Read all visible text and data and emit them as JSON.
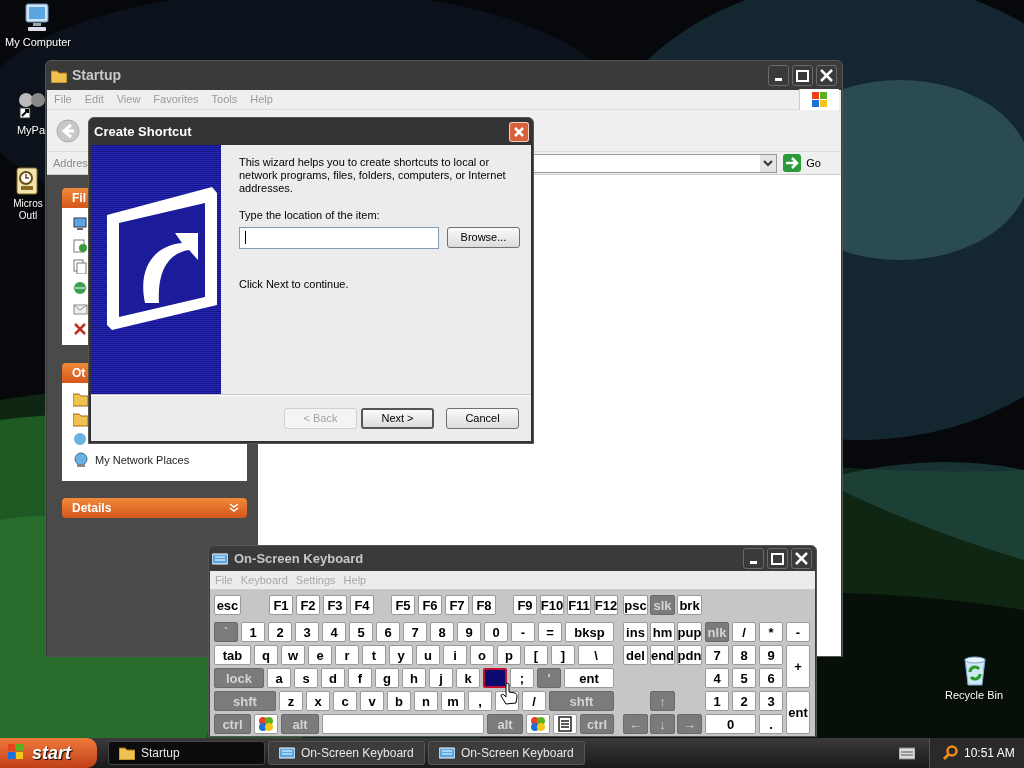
{
  "desktop_icons": [
    {
      "lines": [
        "My Computer"
      ]
    },
    {
      "lines": [
        "MyPa"
      ]
    },
    {
      "lines": [
        "Micros",
        "Outl"
      ]
    },
    {
      "lines": [
        "Recycle Bin"
      ]
    }
  ],
  "explorer": {
    "title": "Startup",
    "menu": [
      "File",
      "Edit",
      "View",
      "Favorites",
      "Tools",
      "Help"
    ],
    "address_label": "Addres",
    "go": "Go",
    "panels": [
      {
        "title": "Fil"
      },
      {
        "title": "Ot",
        "items": [
          {
            "label": "My Network Places"
          }
        ]
      },
      {
        "title": "Details"
      }
    ]
  },
  "dialog": {
    "title": "Create Shortcut",
    "intro": "This wizard helps you to create shortcuts to local or network programs, files, folders, computers, or Internet addresses.",
    "prompt": "Type the location of the item:",
    "browse": "Browse...",
    "hint": "Click Next to continue.",
    "buttons": [
      {
        "label": "< Back",
        "disabled": true,
        "default": false
      },
      {
        "label": "Next >",
        "disabled": false,
        "default": true
      },
      {
        "label": "Cancel",
        "disabled": false,
        "default": false
      }
    ]
  },
  "keyboard": {
    "title": "On-Screen Keyboard",
    "menu": [
      "File",
      "Keyboard",
      "Settings",
      "Help"
    ],
    "function_row": [
      {
        "kind": "text",
        "label": "esc",
        "dark": false,
        "selected": false
      },
      {
        "kind": "text",
        "label": "F1",
        "dark": false,
        "selected": false
      },
      {
        "kind": "text",
        "label": "F2",
        "dark": false,
        "selected": false
      },
      {
        "kind": "text",
        "label": "F3",
        "dark": false,
        "selected": false
      },
      {
        "kind": "text",
        "label": "F4",
        "dark": false,
        "selected": false
      },
      {
        "kind": "text",
        "label": "F5",
        "dark": false,
        "selected": false
      },
      {
        "kind": "text",
        "label": "F6",
        "dark": false,
        "selected": false
      },
      {
        "kind": "text",
        "label": "F7",
        "dark": false,
        "selected": false
      },
      {
        "kind": "text",
        "label": "F8",
        "dark": false,
        "selected": false
      },
      {
        "kind": "text",
        "label": "F9",
        "dark": false,
        "selected": false
      },
      {
        "kind": "text",
        "label": "F10",
        "dark": false,
        "selected": false
      },
      {
        "kind": "text",
        "label": "F11",
        "dark": false,
        "selected": false
      },
      {
        "kind": "text",
        "label": "F12",
        "dark": false,
        "selected": false
      },
      {
        "kind": "text",
        "label": "psc",
        "dark": false,
        "selected": false
      },
      {
        "kind": "text",
        "label": "slk",
        "dark": true,
        "selected": false
      },
      {
        "kind": "text",
        "label": "brk",
        "dark": false,
        "selected": false
      }
    ],
    "main_rows": [
      [
        {
          "kind": "text",
          "label": "`",
          "dark": true,
          "selected": false
        },
        {
          "kind": "text",
          "label": "1",
          "dark": false,
          "selected": false
        },
        {
          "kind": "text",
          "label": "2",
          "dark": false,
          "selected": false
        },
        {
          "kind": "text",
          "label": "3",
          "dark": false,
          "selected": false
        },
        {
          "kind": "text",
          "label": "4",
          "dark": false,
          "selected": false
        },
        {
          "kind": "text",
          "label": "5",
          "dark": false,
          "selected": false
        },
        {
          "kind": "text",
          "label": "6",
          "dark": false,
          "selected": false
        },
        {
          "kind": "text",
          "label": "7",
          "dark": false,
          "selected": false
        },
        {
          "kind": "text",
          "label": "8",
          "dark": false,
          "selected": false
        },
        {
          "kind": "text",
          "label": "9",
          "dark": false,
          "selected": false
        },
        {
          "kind": "text",
          "label": "0",
          "dark": false,
          "selected": false
        },
        {
          "kind": "text",
          "label": "-",
          "dark": false,
          "selected": false
        },
        {
          "kind": "text",
          "label": "=",
          "dark": false,
          "selected": false
        },
        {
          "kind": "text",
          "label": "bksp",
          "dark": false,
          "selected": false
        }
      ],
      [
        {
          "kind": "text",
          "label": "tab",
          "dark": false,
          "selected": false
        },
        {
          "kind": "text",
          "label": "q",
          "dark": false,
          "selected": false
        },
        {
          "kind": "text",
          "label": "w",
          "dark": false,
          "selected": false
        },
        {
          "kind": "text",
          "label": "e",
          "dark": false,
          "selected": false
        },
        {
          "kind": "text",
          "label": "r",
          "dark": false,
          "selected": false
        },
        {
          "kind": "text",
          "label": "t",
          "dark": false,
          "selected": false
        },
        {
          "kind": "text",
          "label": "y",
          "dark": false,
          "selected": false
        },
        {
          "kind": "text",
          "label": "u",
          "dark": false,
          "selected": false
        },
        {
          "kind": "text",
          "label": "i",
          "dark": false,
          "selected": false
        },
        {
          "kind": "text",
          "label": "o",
          "dark": false,
          "selected": false
        },
        {
          "kind": "text",
          "label": "p",
          "dark": false,
          "selected": false
        },
        {
          "kind": "text",
          "label": "[",
          "dark": false,
          "selected": false
        },
        {
          "kind": "text",
          "label": "]",
          "dark": false,
          "selected": false
        },
        {
          "kind": "text",
          "label": "\\",
          "dark": false,
          "selected": false
        }
      ],
      [
        {
          "kind": "text",
          "label": "lock",
          "dark": true,
          "selected": false
        },
        {
          "kind": "text",
          "label": "a",
          "dark": false,
          "selected": false
        },
        {
          "kind": "text",
          "label": "s",
          "dark": false,
          "selected": false
        },
        {
          "kind": "text",
          "label": "d",
          "dark": false,
          "selected": false
        },
        {
          "kind": "text",
          "label": "f",
          "dark": false,
          "selected": false
        },
        {
          "kind": "text",
          "label": "g",
          "dark": false,
          "selected": false
        },
        {
          "kind": "text",
          "label": "h",
          "dark": false,
          "selected": false
        },
        {
          "kind": "text",
          "label": "j",
          "dark": false,
          "selected": false
        },
        {
          "kind": "text",
          "label": "k",
          "dark": false,
          "selected": false
        },
        {
          "kind": "blank",
          "dark": false,
          "selected": true
        },
        {
          "kind": "text",
          "label": ";",
          "dark": false,
          "selected": false
        },
        {
          "kind": "text",
          "label": "'",
          "dark": true,
          "selected": false
        },
        {
          "kind": "text",
          "label": "ent",
          "dark": false,
          "selected": false
        }
      ],
      [
        {
          "kind": "text",
          "label": "shft",
          "dark": true,
          "selected": false
        },
        {
          "kind": "text",
          "label": "z",
          "dark": false,
          "selected": false
        },
        {
          "kind": "text",
          "label": "x",
          "dark": false,
          "selected": false
        },
        {
          "kind": "text",
          "label": "c",
          "dark": false,
          "selected": false
        },
        {
          "kind": "text",
          "label": "v",
          "dark": false,
          "selected": false
        },
        {
          "kind": "text",
          "label": "b",
          "dark": false,
          "selected": false
        },
        {
          "kind": "text",
          "label": "n",
          "dark": false,
          "selected": false
        },
        {
          "kind": "text",
          "label": "m",
          "dark": false,
          "selected": false
        },
        {
          "kind": "text",
          "label": ",",
          "dark": false,
          "selected": false
        },
        {
          "kind": "blank",
          "dark": false,
          "selected": false
        },
        {
          "kind": "text",
          "label": "/",
          "dark": false,
          "selected": false
        },
        {
          "kind": "text",
          "label": "shft",
          "dark": true,
          "selected": false
        }
      ],
      [
        {
          "kind": "text",
          "label": "ctrl",
          "dark": true,
          "selected": false
        },
        {
          "kind": "logo",
          "dark": false,
          "selected": false
        },
        {
          "kind": "text",
          "label": "alt",
          "dark": true,
          "selected": false
        },
        {
          "kind": "blank",
          "dark": false,
          "selected": false
        },
        {
          "kind": "text",
          "label": "alt",
          "dark": true,
          "selected": false
        },
        {
          "kind": "logo",
          "dark": false,
          "selected": false
        },
        {
          "kind": "menu",
          "dark": false,
          "selected": false
        },
        {
          "kind": "text",
          "label": "ctrl",
          "dark": true,
          "selected": false
        }
      ]
    ],
    "nav_keys": [
      {
        "kind": "text",
        "label": "ins",
        "dark": false,
        "selected": false
      },
      {
        "kind": "text",
        "label": "hm",
        "dark": false,
        "selected": false
      },
      {
        "kind": "text",
        "label": "pup",
        "dark": false,
        "selected": false
      },
      {
        "kind": "text",
        "label": "del",
        "dark": false,
        "selected": false
      },
      {
        "kind": "text",
        "label": "end",
        "dark": false,
        "selected": false
      },
      {
        "kind": "text",
        "label": "pdn",
        "dark": false,
        "selected": false
      },
      {
        "kind": "text",
        "label": "↑",
        "dark": true,
        "selected": false
      },
      {
        "kind": "text",
        "label": "←",
        "dark": true,
        "selected": false
      },
      {
        "kind": "text",
        "label": "↓",
        "dark": true,
        "selected": false
      },
      {
        "kind": "text",
        "label": "→",
        "dark": true,
        "selected": false
      }
    ],
    "numpad": [
      {
        "kind": "text",
        "label": "nlk",
        "dark": true,
        "selected": false
      },
      {
        "kind": "text",
        "label": "/",
        "dark": false,
        "selected": false
      },
      {
        "kind": "text",
        "label": "*",
        "dark": false,
        "selected": false
      },
      {
        "kind": "text",
        "label": "-",
        "dark": false,
        "selected": false
      },
      {
        "kind": "text",
        "label": "7",
        "dark": false,
        "selected": false
      },
      {
        "kind": "text",
        "label": "8",
        "dark": false,
        "selected": false
      },
      {
        "kind": "text",
        "label": "9",
        "dark": false,
        "selected": false
      },
      {
        "kind": "text",
        "label": "+",
        "dark": false,
        "selected": false
      },
      {
        "kind": "text",
        "label": "4",
        "dark": false,
        "selected": false
      },
      {
        "kind": "text",
        "label": "5",
        "dark": false,
        "selected": false
      },
      {
        "kind": "text",
        "label": "6",
        "dark": false,
        "selected": false
      },
      {
        "kind": "text",
        "label": "1",
        "dark": false,
        "selected": false
      },
      {
        "kind": "text",
        "label": "2",
        "dark": false,
        "selected": false
      },
      {
        "kind": "text",
        "label": "3",
        "dark": false,
        "selected": false
      },
      {
        "kind": "text",
        "label": "ent",
        "dark": false,
        "selected": false
      },
      {
        "kind": "text",
        "label": "0",
        "dark": false,
        "selected": false
      },
      {
        "kind": "text",
        "label": ".",
        "dark": false,
        "selected": false
      }
    ]
  },
  "taskbar": {
    "start": "start",
    "tasks": [
      {
        "label": "Startup",
        "selected": true
      },
      {
        "label": "On-Screen Keyboard",
        "selected": false
      },
      {
        "label": "On-Screen Keyboard",
        "selected": false
      }
    ],
    "clock": "10:51 AM"
  }
}
